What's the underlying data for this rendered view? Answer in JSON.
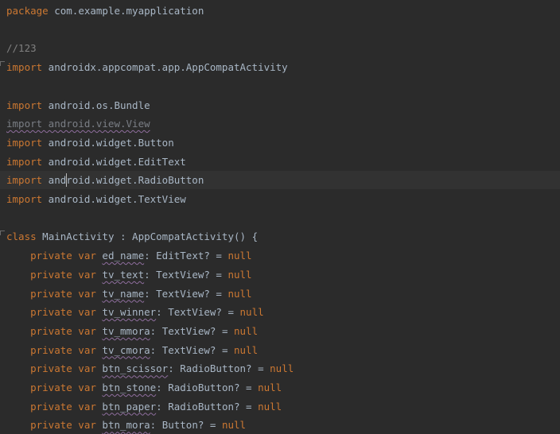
{
  "editor": {
    "language": "kotlin",
    "colors": {
      "background": "#2b2b2b",
      "current_line": "#323232",
      "keyword": "#cc7832",
      "identifier": "#a9b7c6",
      "comment": "#808080",
      "unused_import": "#7a7e85",
      "warning_underline": "#8f6e9e"
    },
    "current_line_index": 9,
    "lines": [
      {
        "tokens": [
          {
            "t": "package",
            "c": "kw"
          },
          {
            "t": " com.example.myapplication",
            "c": "id"
          }
        ]
      },
      {
        "tokens": []
      },
      {
        "tokens": [
          {
            "t": "//123",
            "c": "cm"
          }
        ]
      },
      {
        "fold": true,
        "tokens": [
          {
            "t": "import",
            "c": "kw"
          },
          {
            "t": " androidx.appcompat.app.AppCompatActivity",
            "c": "id"
          }
        ]
      },
      {
        "tokens": []
      },
      {
        "tokens": [
          {
            "t": "import",
            "c": "kw"
          },
          {
            "t": " android.os.Bundle",
            "c": "id"
          }
        ]
      },
      {
        "tokens": [
          {
            "t": "import android.view.View",
            "c": "wavy-dim"
          }
        ]
      },
      {
        "tokens": [
          {
            "t": "import",
            "c": "kw"
          },
          {
            "t": " android.widget.Button",
            "c": "id"
          }
        ]
      },
      {
        "tokens": [
          {
            "t": "import",
            "c": "kw"
          },
          {
            "t": " android.widget.EditText",
            "c": "id"
          }
        ]
      },
      {
        "tokens": [
          {
            "t": "import",
            "c": "kw"
          },
          {
            "t": " android.widget.RadioButton",
            "c": "id"
          }
        ]
      },
      {
        "tokens": [
          {
            "t": "import",
            "c": "kw"
          },
          {
            "t": " android.widget.TextView",
            "c": "id"
          }
        ]
      },
      {
        "tokens": []
      },
      {
        "fold": true,
        "tokens": [
          {
            "t": "class",
            "c": "kw"
          },
          {
            "t": " MainActivity : AppCompatActivity() {",
            "c": "id"
          }
        ]
      },
      {
        "tokens": [
          {
            "t": "    private var ",
            "c": "kw"
          },
          {
            "t": "ed_name",
            "c": "wavy"
          },
          {
            "t": ": EditText? = ",
            "c": "id"
          },
          {
            "t": "null",
            "c": "kw"
          }
        ]
      },
      {
        "tokens": [
          {
            "t": "    private var ",
            "c": "kw"
          },
          {
            "t": "tv_text",
            "c": "wavy"
          },
          {
            "t": ": TextView? = ",
            "c": "id"
          },
          {
            "t": "null",
            "c": "kw"
          }
        ]
      },
      {
        "tokens": [
          {
            "t": "    private var ",
            "c": "kw"
          },
          {
            "t": "tv_name",
            "c": "wavy"
          },
          {
            "t": ": TextView? = ",
            "c": "id"
          },
          {
            "t": "null",
            "c": "kw"
          }
        ]
      },
      {
        "tokens": [
          {
            "t": "    private var ",
            "c": "kw"
          },
          {
            "t": "tv_winner",
            "c": "wavy"
          },
          {
            "t": ": TextView? = ",
            "c": "id"
          },
          {
            "t": "null",
            "c": "kw"
          }
        ]
      },
      {
        "tokens": [
          {
            "t": "    private var ",
            "c": "kw"
          },
          {
            "t": "tv_mmora",
            "c": "wavy"
          },
          {
            "t": ": TextView? = ",
            "c": "id"
          },
          {
            "t": "null",
            "c": "kw"
          }
        ]
      },
      {
        "tokens": [
          {
            "t": "    private var ",
            "c": "kw"
          },
          {
            "t": "tv_cmora",
            "c": "wavy"
          },
          {
            "t": ": TextView? = ",
            "c": "id"
          },
          {
            "t": "null",
            "c": "kw"
          }
        ]
      },
      {
        "tokens": [
          {
            "t": "    private var ",
            "c": "kw"
          },
          {
            "t": "btn_scissor",
            "c": "wavy"
          },
          {
            "t": ": RadioButton? = ",
            "c": "id"
          },
          {
            "t": "null",
            "c": "kw"
          }
        ]
      },
      {
        "tokens": [
          {
            "t": "    private var ",
            "c": "kw"
          },
          {
            "t": "btn_stone",
            "c": "wavy"
          },
          {
            "t": ": RadioButton? = ",
            "c": "id"
          },
          {
            "t": "null",
            "c": "kw"
          }
        ]
      },
      {
        "tokens": [
          {
            "t": "    private var ",
            "c": "kw"
          },
          {
            "t": "btn_paper",
            "c": "wavy"
          },
          {
            "t": ": RadioButton? = ",
            "c": "id"
          },
          {
            "t": "null",
            "c": "kw"
          }
        ]
      },
      {
        "tokens": [
          {
            "t": "    private var ",
            "c": "kw"
          },
          {
            "t": "btn_mora",
            "c": "wavy"
          },
          {
            "t": ": Button? = ",
            "c": "id"
          },
          {
            "t": "null",
            "c": "kw"
          }
        ]
      }
    ]
  }
}
